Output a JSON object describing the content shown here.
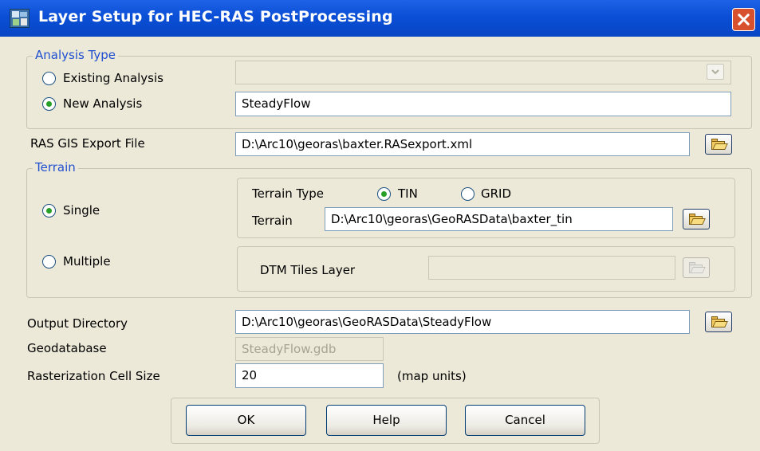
{
  "window": {
    "title": "Layer Setup for HEC-RAS PostProcessing"
  },
  "analysis_type": {
    "legend": "Analysis Type",
    "existing_label": "Existing Analysis",
    "new_label": "New Analysis",
    "existing_value": "",
    "new_value": "SteadyFlow"
  },
  "export": {
    "label": "RAS GIS Export File",
    "value": "D:\\Arc10\\georas\\baxter.RASexport.xml"
  },
  "terrain": {
    "legend": "Terrain",
    "single_label": "Single",
    "multiple_label": "Multiple",
    "type_label": "Terrain Type",
    "tin_label": "TIN",
    "grid_label": "GRID",
    "terrain_label": "Terrain",
    "terrain_value": "D:\\Arc10\\georas\\GeoRASData\\baxter_tin",
    "dtm_label": "DTM Tiles Layer",
    "dtm_value": ""
  },
  "output": {
    "label": "Output Directory",
    "value": "D:\\Arc10\\georas\\GeoRASData\\SteadyFlow"
  },
  "geodatabase": {
    "label": "Geodatabase",
    "value": "SteadyFlow.gdb"
  },
  "raster": {
    "label": "Rasterization Cell Size",
    "value": "20",
    "units": "(map units)"
  },
  "buttons": {
    "ok": "OK",
    "help": "Help",
    "cancel": "Cancel"
  },
  "icons": {
    "title": "app-icon",
    "close": "close-icon",
    "browse": "open-folder-icon",
    "dropdown": "chevron-down-icon"
  },
  "colors": {
    "titlebar": "#0a4fd6",
    "dialog_bg": "#ece9d8",
    "legend_text": "#1f4fd1",
    "radio_dot": "#27a02a",
    "close_button": "#d8512f"
  }
}
